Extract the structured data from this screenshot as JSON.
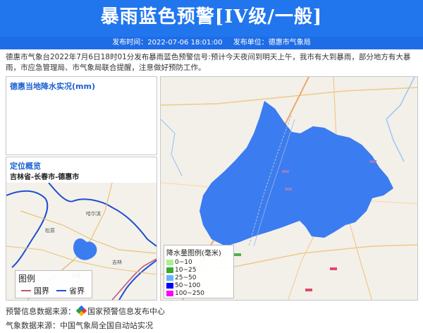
{
  "header": {
    "title": "暴雨蓝色预警[IV级/一般]",
    "publish_time": "发布时间：2022-07-06 18:01:00",
    "publish_unit": "发布单位：德惠市气象局"
  },
  "description": "德惠市气象台2022年7月6日18时01分发布暴雨蓝色预警信号:预计今天夜间到明天上午，我市有大到暴雨，部分地方有大暴雨，市应急管理局、市气象局联合提醒，注意做好预防工作。",
  "rain_panel": {
    "title": "德惠当地降水实况(mm)"
  },
  "location_panel": {
    "title": "定位概览",
    "path": "吉林省-长春市-德惠市",
    "map_labels": [
      "哈尔滨",
      "长春",
      "松原",
      "吉林",
      "四平"
    ],
    "legend": {
      "title": "图例",
      "items": [
        {
          "label": "国界",
          "color": "#c2567a"
        },
        {
          "label": "省界",
          "color": "#1f4fd0"
        }
      ]
    }
  },
  "main_map": {
    "region_color": "#3b7cf0",
    "legend": {
      "title": "降水量图例(毫米)",
      "items": [
        {
          "label": "0~10",
          "color": "#a6f28f"
        },
        {
          "label": "10~25",
          "color": "#3ba82e"
        },
        {
          "label": "25~50",
          "color": "#60b8ff"
        },
        {
          "label": "50~100",
          "color": "#0000fe"
        },
        {
          "label": "100~250",
          "color": "#fa00fa"
        }
      ]
    }
  },
  "sources": {
    "warning_prefix": "预警信息数据来源：",
    "warning_org": "国家预警信息发布中心",
    "weather_line": "气象数据来源：中国气象局全国自动站实况"
  }
}
